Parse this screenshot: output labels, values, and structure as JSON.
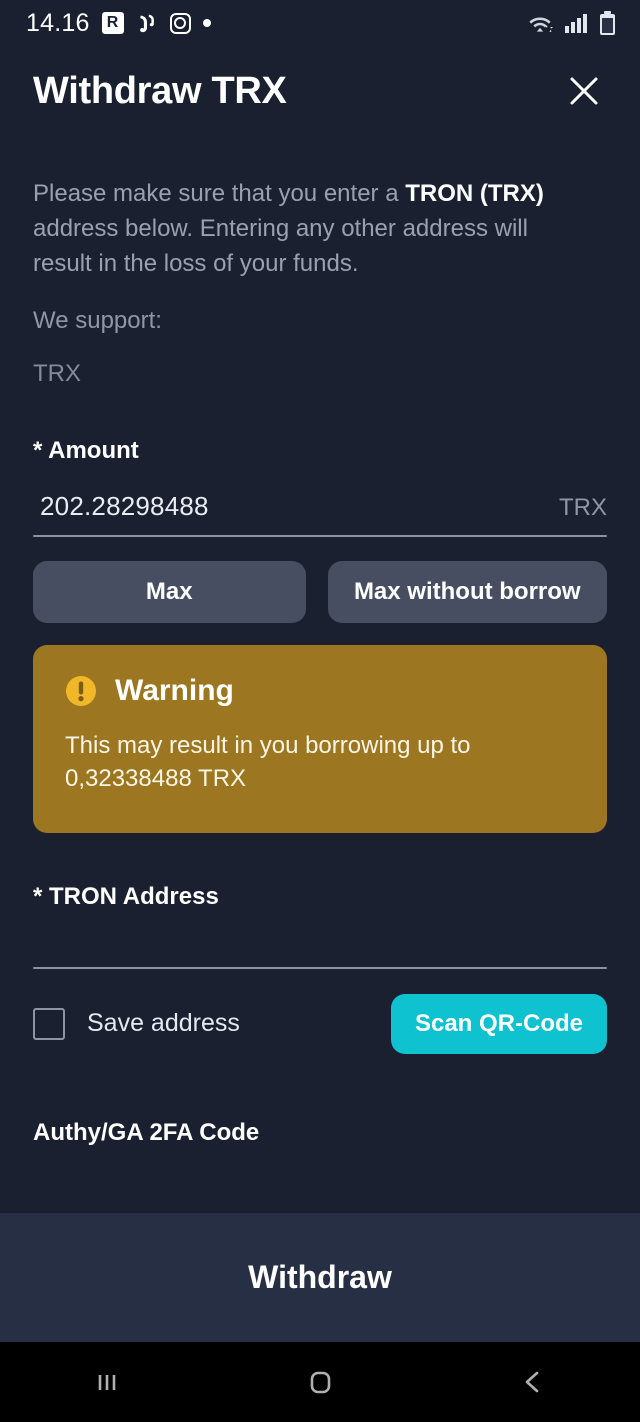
{
  "status_bar": {
    "time": "14.16",
    "left_icons": [
      "r-badge-icon",
      "bird-icon",
      "instagram-icon",
      "dot-icon"
    ],
    "right_icons": [
      "wifi-icon",
      "cellular-signal-icon",
      "battery-icon"
    ]
  },
  "header": {
    "title": "Withdraw TRX",
    "close_icon": "close-icon"
  },
  "intro": {
    "part1": "Please make sure that you enter a ",
    "emphasis": "TRON (TRX)",
    "part2": " address below. Entering any other address will result in the loss of your funds.",
    "support_label": "We support:",
    "support_items": [
      "TRX"
    ]
  },
  "amount": {
    "label": "* Amount",
    "value": "202.28298488",
    "placeholder": "",
    "unit": "TRX",
    "max_button": "Max",
    "max_without_borrow_button": "Max without borrow"
  },
  "warning": {
    "icon": "warning-icon",
    "title": "Warning",
    "message": "This may result in you borrowing up to 0,32338488 TRX",
    "background_color": "#9c7620",
    "icon_color": "#f0b728"
  },
  "address": {
    "label": "* TRON Address",
    "value": "",
    "placeholder": "",
    "save_checkbox_label": "Save address",
    "save_checked": false,
    "scan_button": "Scan QR-Code",
    "scan_button_color": "#0ec2d0"
  },
  "twofa": {
    "label": "Authy/GA 2FA Code",
    "value": "",
    "placeholder": ""
  },
  "footer": {
    "submit_label": "Withdraw"
  },
  "navbar": {
    "recents": "recents-icon",
    "home": "home-icon",
    "back": "back-icon"
  },
  "theme": {
    "background": "#1a2030",
    "footer_background": "#272f45",
    "button_secondary": "#474e61",
    "accent": "#0ec2d0"
  }
}
